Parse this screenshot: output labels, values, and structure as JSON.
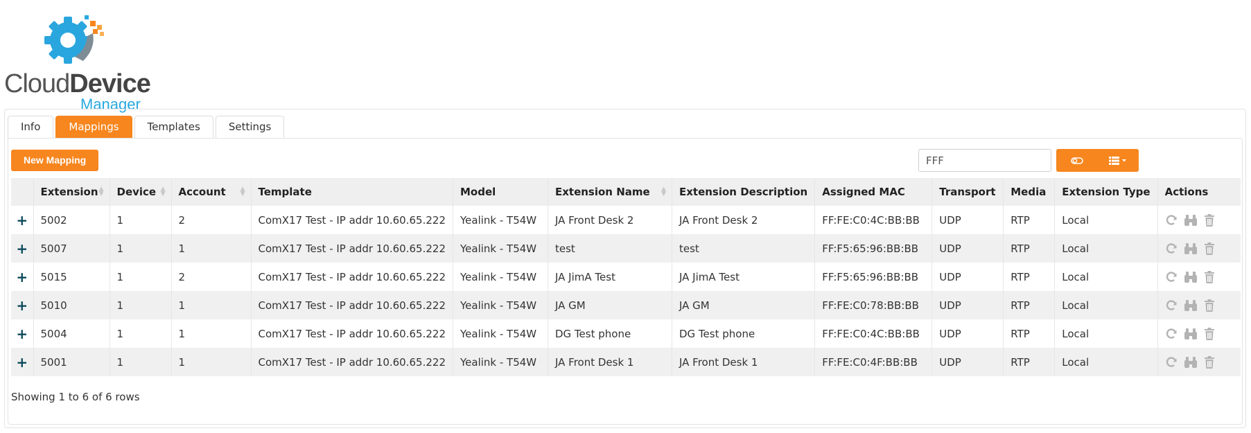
{
  "logo": {
    "cloud": "Cloud",
    "device": "Device",
    "manager": "Manager"
  },
  "tabs": [
    {
      "label": "Info",
      "active": false
    },
    {
      "label": "Mappings",
      "active": true
    },
    {
      "label": "Templates",
      "active": false
    },
    {
      "label": "Settings",
      "active": false
    }
  ],
  "toolbar": {
    "new_mapping_label": "New Mapping",
    "search_value": "FFF",
    "toggle_icon": "toggle-icon",
    "columns_icon": "list-columns-icon"
  },
  "table": {
    "columns": [
      "Extension",
      "Device",
      "Account",
      "Template",
      "Model",
      "Extension Name",
      "Extension Description",
      "Assigned MAC",
      "Transport",
      "Media",
      "Extension Type",
      "Actions"
    ],
    "rows": [
      {
        "extension": "5002",
        "device": "1",
        "account": "2",
        "template": "ComX17 Test - IP addr 10.60.65.222",
        "model": "Yealink - T54W",
        "name": "JA Front Desk 2",
        "description": "JA Front Desk 2",
        "mac": "FF:FE:C0:4C:BB:BB",
        "transport": "UDP",
        "media": "RTP",
        "type": "Local"
      },
      {
        "extension": "5007",
        "device": "1",
        "account": "1",
        "template": "ComX17 Test - IP addr 10.60.65.222",
        "model": "Yealink - T54W",
        "name": "test",
        "description": "test",
        "mac": "FF:F5:65:96:BB:BB",
        "transport": "UDP",
        "media": "RTP",
        "type": "Local"
      },
      {
        "extension": "5015",
        "device": "1",
        "account": "2",
        "template": "ComX17 Test - IP addr 10.60.65.222",
        "model": "Yealink - T54W",
        "name": "JA JimA Test",
        "description": "JA JimA Test",
        "mac": "FF:F5:65:96:BB:BB",
        "transport": "UDP",
        "media": "RTP",
        "type": "Local"
      },
      {
        "extension": "5010",
        "device": "1",
        "account": "1",
        "template": "ComX17 Test - IP addr 10.60.65.222",
        "model": "Yealink - T54W",
        "name": "JA GM",
        "description": "JA GM",
        "mac": "FF:FE:C0:78:BB:BB",
        "transport": "UDP",
        "media": "RTP",
        "type": "Local"
      },
      {
        "extension": "5004",
        "device": "1",
        "account": "1",
        "template": "ComX17 Test - IP addr 10.60.65.222",
        "model": "Yealink - T54W",
        "name": "DG Test phone",
        "description": "DG Test phone",
        "mac": "FF:FE:C0:4C:BB:BB",
        "transport": "UDP",
        "media": "RTP",
        "type": "Local"
      },
      {
        "extension": "5001",
        "device": "1",
        "account": "1",
        "template": "ComX17 Test - IP addr 10.60.65.222",
        "model": "Yealink - T54W",
        "name": "JA Front Desk 1",
        "description": "JA Front Desk 1",
        "mac": "FF:FE:C0:4F:BB:BB",
        "transport": "UDP",
        "media": "RTP",
        "type": "Local"
      }
    ],
    "expand_symbol": "+",
    "action_icons": [
      "refresh-icon",
      "binoculars-icon",
      "trash-icon"
    ]
  },
  "footer": {
    "showing_text": "Showing 1 to 6 of 6 rows"
  },
  "colors": {
    "accent": "#f7861e",
    "expand": "#0c4a5a",
    "brand_blue": "#29a8e0"
  }
}
